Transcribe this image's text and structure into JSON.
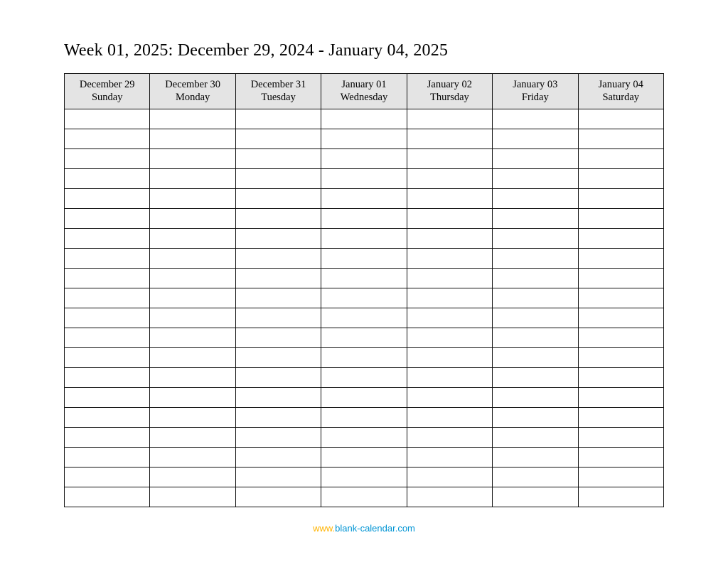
{
  "title": "Week 01, 2025: December 29, 2024 - January 04, 2025",
  "columns": [
    {
      "date": "December 29",
      "day": "Sunday"
    },
    {
      "date": "December 30",
      "day": "Monday"
    },
    {
      "date": "December 31",
      "day": "Tuesday"
    },
    {
      "date": "January 01",
      "day": "Wednesday"
    },
    {
      "date": "January 02",
      "day": "Thursday"
    },
    {
      "date": "January 03",
      "day": "Friday"
    },
    {
      "date": "January 04",
      "day": "Saturday"
    }
  ],
  "row_count": 20,
  "footer": {
    "prefix": "www.",
    "domain": "blank-calendar.com"
  }
}
